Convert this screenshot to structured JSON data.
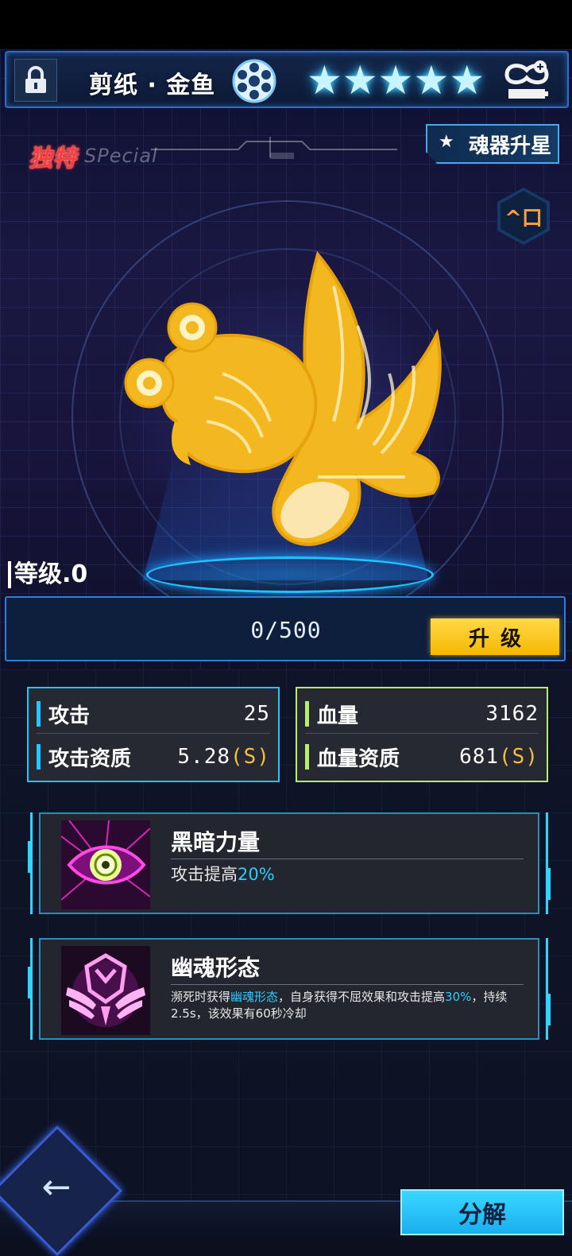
{
  "header": {
    "title": "剪纸 · 金鱼",
    "stars": [
      "★",
      "★",
      "★",
      "★",
      "★"
    ]
  },
  "tag": {
    "cn": "独特",
    "en": "SPecial"
  },
  "star_up_button": "魂器升星",
  "hex_button_label": "^口",
  "level": {
    "label": "等级.0",
    "progress_text": "0/500",
    "progress": 0,
    "upgrade_label": "升级"
  },
  "stats": {
    "attack": {
      "label": "攻击",
      "value": "25",
      "quality_label": "攻击资质",
      "quality_value": "5.28",
      "quality_grade": "(S)"
    },
    "hp": {
      "label": "血量",
      "value": "3162",
      "quality_label": "血量资质",
      "quality_value": "681",
      "quality_grade": "(S)"
    }
  },
  "skills": [
    {
      "name": "黑暗力量",
      "desc_prefix": "攻击提高",
      "desc_highlight": "20%"
    },
    {
      "name": "幽魂形态",
      "desc_a": "濒死时获得",
      "desc_b": "幽魂形态",
      "desc_c": "，自身获得不屈效果和攻击提高",
      "desc_d": "30%",
      "desc_e": "，持续2.5s，该效果有60秒冷却"
    }
  ],
  "footer": {
    "decompose_label": "分解"
  },
  "colors": {
    "accent_cyan": "#24c6ff",
    "accent_green": "#b6f06a",
    "upgrade_yellow": "#f6b800",
    "grade_gold": "#f0c040"
  }
}
